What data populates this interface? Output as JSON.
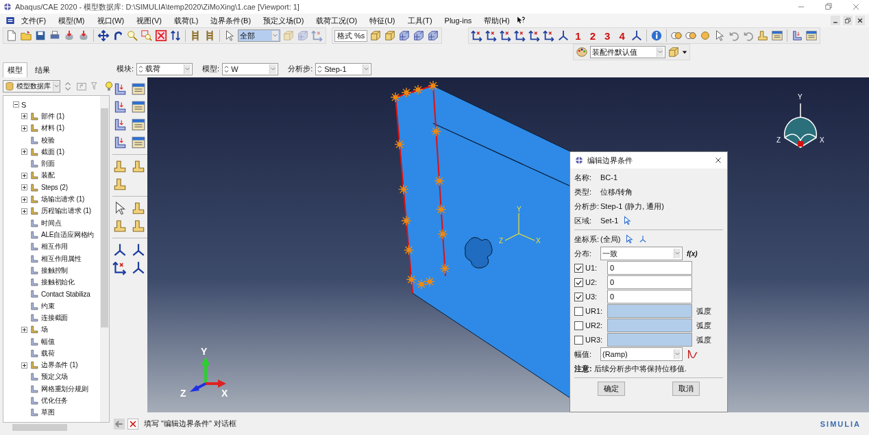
{
  "window": {
    "title": "Abaqus/CAE 2020 - 模型数据库: D:\\SIMULIA\\temp2020\\ZiMoXing\\1.cae [Viewport: 1]"
  },
  "menu": [
    "文件(F)",
    "模型(M)",
    "视口(W)",
    "视图(V)",
    "载荷(L)",
    "边界条件(B)",
    "预定义场(D)",
    "载荷工况(O)",
    "特征(U)",
    "工具(T)",
    "Plug-ins",
    "帮助(H)"
  ],
  "toolbar": {
    "selection_filter": "全部",
    "format": "格式 %s",
    "view_numbers": [
      "1",
      "2",
      "3",
      "4"
    ],
    "display_group": "装配件默认值"
  },
  "context": {
    "module_label": "模块:",
    "module": "载荷",
    "model_label": "模型:",
    "model": "W",
    "step_label": "分析步:",
    "step": "Step-1"
  },
  "tabs": [
    {
      "label": "模型",
      "selected": true
    },
    {
      "label": "结果",
      "selected": false
    }
  ],
  "tree": {
    "database": "模型数据库",
    "root": {
      "label": "S",
      "expanded": true,
      "children": [
        {
          "label": "部件 (1)",
          "kind": "folder"
        },
        {
          "label": "材料 (1)",
          "kind": "folder"
        },
        {
          "label": "校验",
          "kind": "leaf"
        },
        {
          "label": "截面 (1)",
          "kind": "folder"
        },
        {
          "label": "剖面",
          "kind": "leaf"
        },
        {
          "label": "装配",
          "kind": "folder"
        },
        {
          "label": "Steps (2)",
          "kind": "folder"
        },
        {
          "label": "场输出请求 (1)",
          "kind": "folder"
        },
        {
          "label": "历程输出请求 (1)",
          "kind": "folder"
        },
        {
          "label": "时间点",
          "kind": "leaf"
        },
        {
          "label": "ALE自适应网格约",
          "kind": "leaf"
        },
        {
          "label": "相互作用",
          "kind": "leaf"
        },
        {
          "label": "相互作用属性",
          "kind": "leaf"
        },
        {
          "label": "接触控制",
          "kind": "leaf"
        },
        {
          "label": "接触初始化",
          "kind": "leaf"
        },
        {
          "label": "Contact Stabiliza",
          "kind": "leaf"
        },
        {
          "label": "约束",
          "kind": "leaf"
        },
        {
          "label": "连接截面",
          "kind": "leaf"
        },
        {
          "label": "场",
          "kind": "folder"
        },
        {
          "label": "幅值",
          "kind": "leaf"
        },
        {
          "label": "载荷",
          "kind": "leaf"
        },
        {
          "label": "边界条件 (1)",
          "kind": "folder"
        },
        {
          "label": "预定义场",
          "kind": "leaf"
        },
        {
          "label": "网格重划分规则",
          "kind": "leaf"
        },
        {
          "label": "优化任务",
          "kind": "leaf"
        },
        {
          "label": "草图",
          "kind": "leaf"
        }
      ]
    }
  },
  "viewport": {
    "local_axes": {
      "y": "Y",
      "x": "X",
      "z": "Z"
    },
    "global_triad": {
      "y": "Y",
      "z": "Z",
      "x": "X"
    },
    "view_cube": {
      "y": "Y",
      "z": "Z",
      "x": "X"
    },
    "logo": "SIMULIA"
  },
  "dialog": {
    "title": "编辑边界条件",
    "info": [
      {
        "label": "名称:",
        "value": "BC-1"
      },
      {
        "label": "类型:",
        "value": "位移/转角"
      },
      {
        "label": "分析步:",
        "value": "Step-1 (静力, 通用)"
      },
      {
        "label": "区域:",
        "value": "Set-1",
        "kind": "picker"
      }
    ],
    "csys": {
      "label": "坐标系:",
      "value": "(全局)"
    },
    "distribution": {
      "label": "分布:",
      "value": "一致",
      "fx": "f(x)"
    },
    "dofs": [
      {
        "label": "U1:",
        "checked": true,
        "value": "0"
      },
      {
        "label": "U2:",
        "checked": true,
        "value": "0"
      },
      {
        "label": "U3:",
        "checked": true,
        "value": "0"
      },
      {
        "label": "UR1:",
        "checked": false,
        "unit": "弧度"
      },
      {
        "label": "UR2:",
        "checked": false,
        "unit": "弧度"
      },
      {
        "label": "UR3:",
        "checked": false,
        "unit": "弧度"
      }
    ],
    "amplitude": {
      "label": "幅值:",
      "value": "(Ramp)"
    },
    "note": "**注意:** 后续分析步中将保持位移值.",
    "buttons": [
      "确定",
      "取消"
    ]
  },
  "status": {
    "prompt": "填写 \"编辑边界条件\" 对话框"
  }
}
